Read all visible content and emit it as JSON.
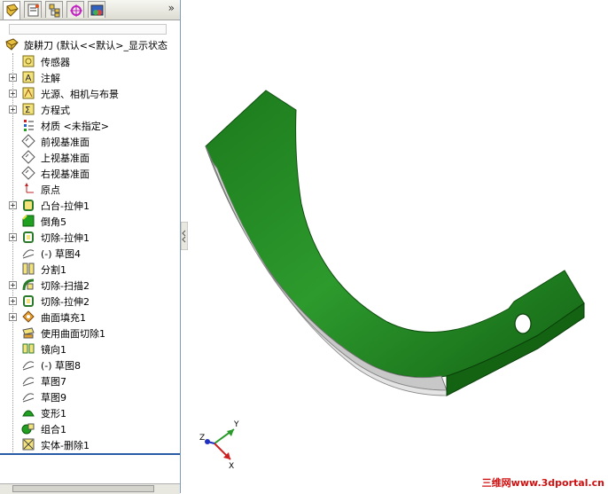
{
  "panel": {
    "tabs": [
      {
        "name": "feature-manager-tab-icon",
        "active": true
      },
      {
        "name": "property-manager-tab-icon",
        "active": false
      },
      {
        "name": "configuration-manager-tab-icon",
        "active": false
      },
      {
        "name": "dimxpert-tab-icon",
        "active": false
      },
      {
        "name": "display-manager-tab-icon",
        "active": false
      }
    ],
    "more_glyph": "»",
    "root_label": "旋耕刀   (默认<<默认>_显示状态",
    "items": [
      {
        "label": "传感器",
        "expand": false,
        "icon": "sensor-icon"
      },
      {
        "label": "注解",
        "expand": true,
        "icon": "annotation-icon"
      },
      {
        "label": "光源、相机与布景",
        "expand": true,
        "icon": "lights-cameras-icon"
      },
      {
        "label": "方程式",
        "expand": true,
        "icon": "equation-icon"
      },
      {
        "label": "材质 <未指定>",
        "expand": false,
        "icon": "material-icon"
      },
      {
        "label": "前视基准面",
        "expand": false,
        "icon": "plane-icon"
      },
      {
        "label": "上视基准面",
        "expand": false,
        "icon": "plane-icon"
      },
      {
        "label": "右视基准面",
        "expand": false,
        "icon": "plane-icon"
      },
      {
        "label": "原点",
        "expand": false,
        "icon": "origin-icon"
      },
      {
        "label": "凸台-拉伸1",
        "expand": true,
        "icon": "boss-extrude-icon"
      },
      {
        "label": "倒角5",
        "expand": false,
        "icon": "chamfer-icon"
      },
      {
        "label": "切除-拉伸1",
        "expand": true,
        "icon": "cut-extrude-icon"
      },
      {
        "label": "(-) 草图4",
        "expand": false,
        "icon": "sketch-icon"
      },
      {
        "label": "分割1",
        "expand": false,
        "icon": "split-icon"
      },
      {
        "label": "切除-扫描2",
        "expand": true,
        "icon": "cut-sweep-icon"
      },
      {
        "label": "切除-拉伸2",
        "expand": true,
        "icon": "cut-extrude-icon"
      },
      {
        "label": "曲面填充1",
        "expand": true,
        "icon": "surface-fill-icon"
      },
      {
        "label": "使用曲面切除1",
        "expand": false,
        "icon": "surface-cut-icon"
      },
      {
        "label": "镜向1",
        "expand": false,
        "icon": "mirror-icon"
      },
      {
        "label": "(-) 草图8",
        "expand": false,
        "icon": "sketch-icon"
      },
      {
        "label": "草图7",
        "expand": false,
        "icon": "sketch-icon"
      },
      {
        "label": "草图9",
        "expand": false,
        "icon": "sketch-icon"
      },
      {
        "label": "变形1",
        "expand": false,
        "icon": "deform-icon"
      },
      {
        "label": "组合1",
        "expand": false,
        "icon": "combine-icon"
      },
      {
        "label": "实体-删除1",
        "expand": false,
        "icon": "body-delete-icon"
      }
    ]
  },
  "triad": {
    "x": "X",
    "y": "Y",
    "z": "Z"
  },
  "watermark": "三维网www.3dportal.cn",
  "colors": {
    "model_green": "#1f7a1f",
    "model_blade": "#c8c8c8",
    "panel_border": "#7f9db9"
  }
}
